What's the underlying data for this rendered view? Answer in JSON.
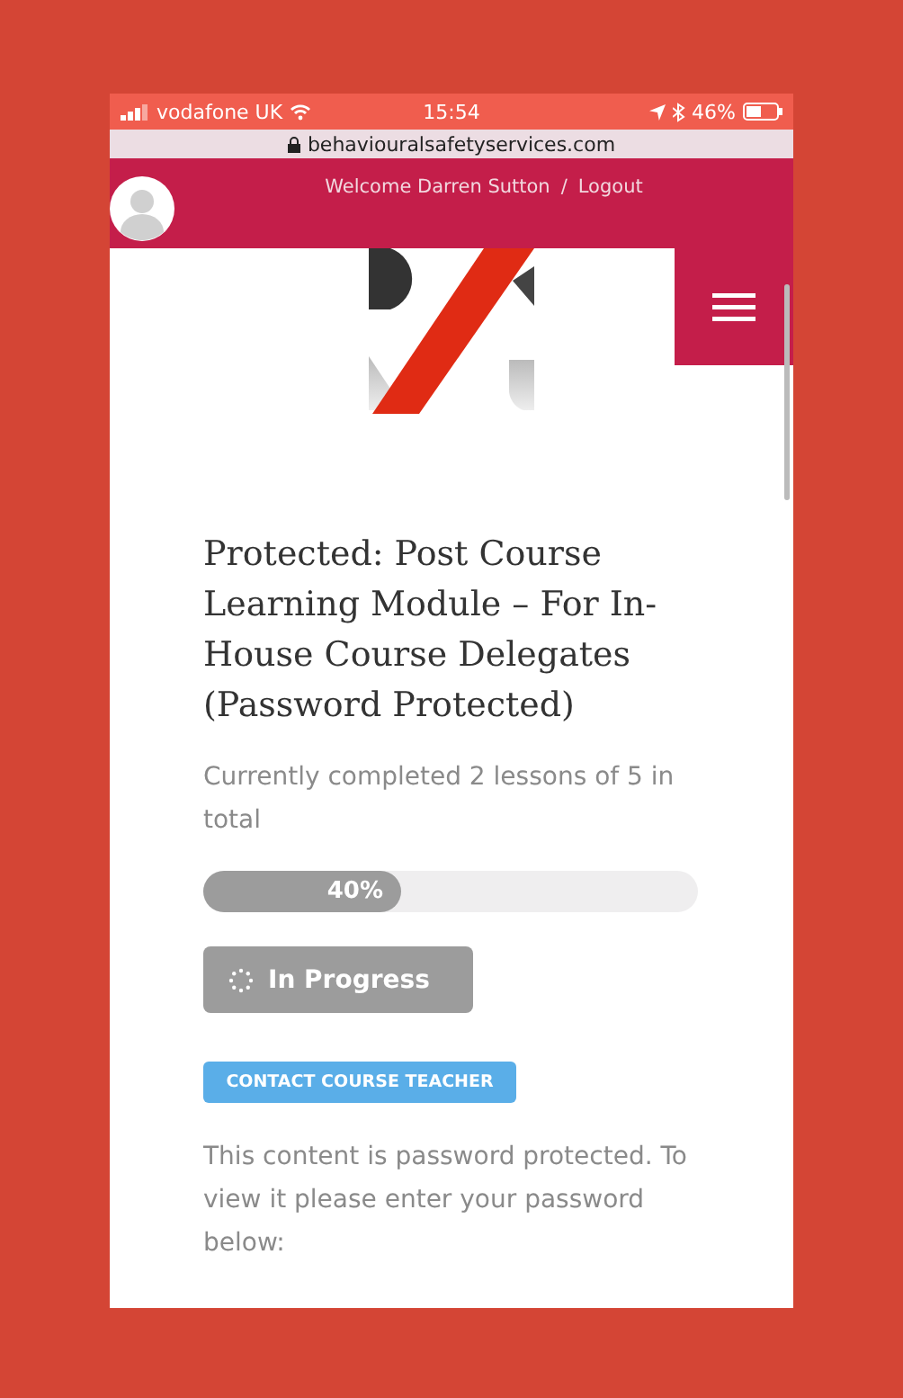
{
  "status_bar": {
    "carrier": "vodafone UK",
    "time": "15:54",
    "battery": "46%"
  },
  "address_bar": {
    "url": "behaviouralsafetyservices.com"
  },
  "header": {
    "welcome": "Welcome Darren Sutton",
    "separator": "/",
    "logout": "Logout"
  },
  "title": "Protected: Post Course Learning Module – For In-House Course Delegates (Password Protected)",
  "lessons": "Currently completed 2 lessons of 5 in total",
  "progress": {
    "level": 0.4,
    "label": "40%"
  },
  "status_button": "In Progress",
  "contact_button": "CONTACT COURSE TEACHER",
  "notice": "This content is password protected. To view it please enter your password below:"
}
